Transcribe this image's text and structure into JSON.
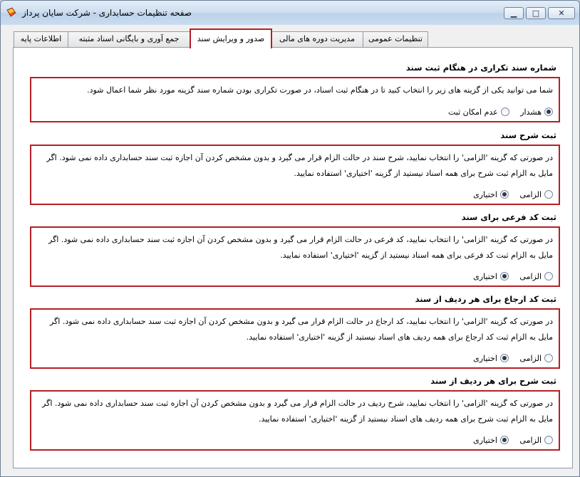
{
  "window": {
    "title": "صفحه تنظیمات حسابداری - شرکت سایان پرداز",
    "minimize_glyph": "▁",
    "maximize_glyph": "□",
    "close_glyph": "✕"
  },
  "tabs": [
    {
      "label": "تنظیمات عمومی",
      "active": false
    },
    {
      "label": "مدیریت دوره های مالی",
      "active": false
    },
    {
      "label": "صدور و ویرایش سند",
      "active": true
    },
    {
      "label": "جمع آوری و بایگانی اسناد مثبته",
      "active": false
    },
    {
      "label": "اطلاعات پایه",
      "active": false
    }
  ],
  "sections": [
    {
      "title": "شماره سند تکراری در هنگام ثبت سند",
      "description": "شما می توانید یکی از گزینه های زیر را انتخاب کنید تا در هنگام ثبت اسناد، در صورت تکراری بودن شماره سند گزینه مورد نظر شما اعمال شود.",
      "options": [
        {
          "label": "هشدار",
          "selected": true
        },
        {
          "label": "عدم امکان ثبت",
          "selected": false
        }
      ]
    },
    {
      "title": "ثبت شرح سند",
      "description": "در صورتی که گزینه 'الزامی' را انتخاب نمایید، شرح سند در حالت الزام قرار می گیرد و بدون مشخص کردن آن اجازه ثبت سند حسابداری داده نمی شود. اگر مایل به الزام ثبت شرح برای همه اسناد نیستید از گزینه 'اختیاری' استفاده نمایید.",
      "options": [
        {
          "label": "الزامی",
          "selected": false
        },
        {
          "label": "اختیاری",
          "selected": true
        }
      ]
    },
    {
      "title": "ثبت کد فرعی برای سند",
      "description": "در صورتی که گزینه 'الزامی' را انتخاب نمایید، کد فرعی در حالت الزام قرار می گیرد و بدون مشخص کردن آن اجازه ثبت سند حسابداری داده نمی شود. اگر مایل به الزام ثبت کد فرعی برای همه اسناد نیستید از گزینه 'اختیاری' استفاده نمایید.",
      "options": [
        {
          "label": "الزامی",
          "selected": false
        },
        {
          "label": "اختیاری",
          "selected": true
        }
      ]
    },
    {
      "title": "ثبت کد ارجاع برای هر ردیف از سند",
      "description": "در صورتی که گزینه 'الزامی' را انتخاب نمایید، کد ارجاع در حالت الزام قرار می گیرد و بدون مشخص کردن آن اجازه ثبت سند حسابداری داده نمی شود. اگر مایل به الزام ثبت کد ارجاع برای همه ردیف های اسناد نیستید از گزینه 'اختیاری' استفاده نمایید.",
      "options": [
        {
          "label": "الزامی",
          "selected": false
        },
        {
          "label": "اختیاری",
          "selected": true
        }
      ]
    },
    {
      "title": "ثبت شرح برای هر ردیف از سند",
      "description": "در صورتی که گزینه 'الزامی' را انتخاب نمایید، شرح ردیف در حالت الزام قرار می گیرد و بدون مشخص کردن آن اجازه ثبت سند حسابداری داده نمی شود. اگر مایل به الزام ثبت شرح برای همه ردیف های اسناد نیستید از گزینه 'اختیاری' استفاده نمایید.",
      "options": [
        {
          "label": "الزامی",
          "selected": false
        },
        {
          "label": "اختیاری",
          "selected": true
        }
      ]
    }
  ],
  "colors": {
    "highlight_border": "#b52024",
    "title_bar": "#cfdff0"
  }
}
